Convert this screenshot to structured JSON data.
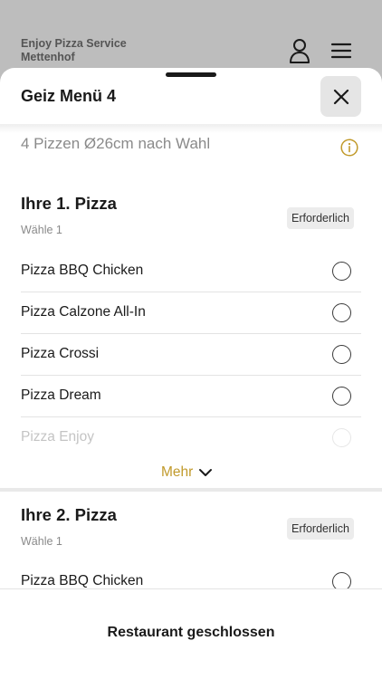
{
  "background": {
    "restaurant_name_line1": "Enjoy Pizza Service",
    "restaurant_name_line2": "Mettenhof",
    "icons": [
      "user-icon",
      "hamburger-menu-icon"
    ]
  },
  "sheet": {
    "title": "Geiz Menü 4",
    "close_icon": "close-icon",
    "description": "4 Pizzen Ø26cm nach Wahl",
    "info_icon": "info-icon"
  },
  "groups": [
    {
      "title": "Ihre 1. Pizza",
      "subtitle": "Wähle 1",
      "badge": "Erforderlich",
      "options": [
        {
          "label": "Pizza BBQ Chicken"
        },
        {
          "label": "Pizza Calzone All-In"
        },
        {
          "label": "Pizza Crossi"
        },
        {
          "label": "Pizza Dream"
        },
        {
          "label": "Pizza Enjoy"
        }
      ],
      "more_label": "Mehr"
    },
    {
      "title": "Ihre 2. Pizza",
      "subtitle": "Wähle 1",
      "badge": "Erforderlich",
      "options": [
        {
          "label": "Pizza BBQ Chicken"
        }
      ]
    }
  ],
  "footer": {
    "label": "Restaurant geschlossen"
  },
  "colors": {
    "accent": "#c19a2b",
    "overlay_background": "#bdbdbd",
    "badge_background": "#ececec"
  }
}
